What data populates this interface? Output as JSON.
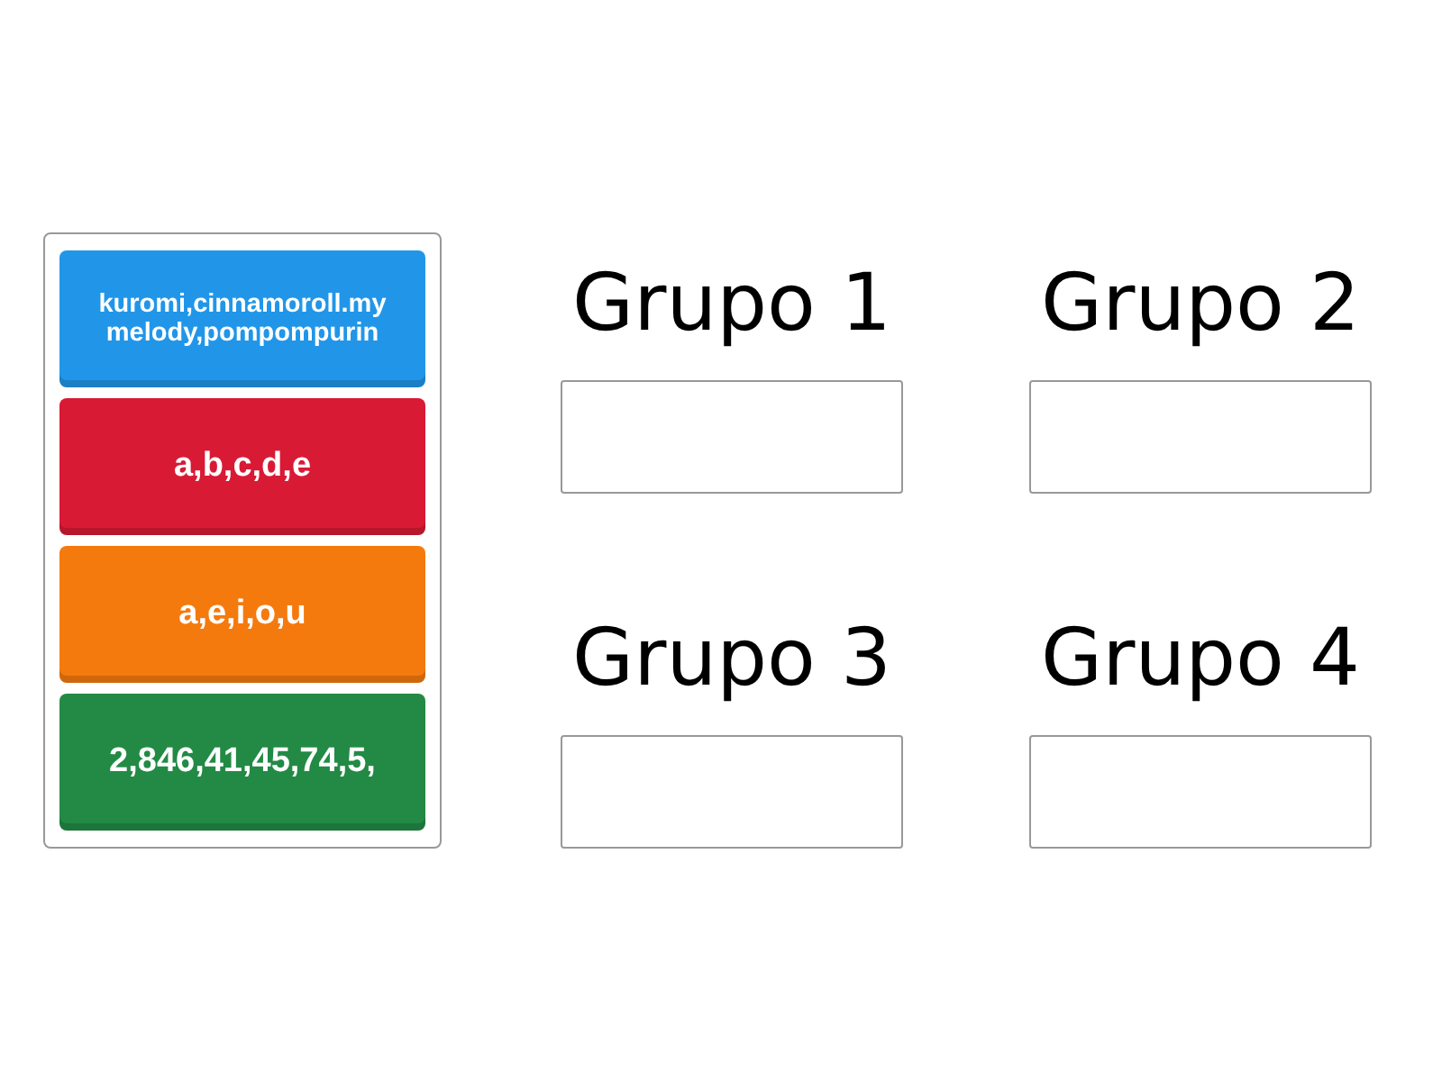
{
  "cards": [
    {
      "label": "kuromi,cinnamoroll.my melody,pompompurin",
      "color": "#2196e8",
      "kind": "small"
    },
    {
      "label": "a,b,c,d,e",
      "color": "#d91a35",
      "kind": "large"
    },
    {
      "label": "a,e,i,o,u",
      "color": "#f57a0e",
      "kind": "large"
    },
    {
      "label": "2,846,41,45,74,5,",
      "color": "#228a45",
      "kind": "large"
    }
  ],
  "groups": [
    {
      "title": "Grupo 1"
    },
    {
      "title": "Grupo 2"
    },
    {
      "title": "Grupo 3"
    },
    {
      "title": "Grupo 4"
    }
  ]
}
